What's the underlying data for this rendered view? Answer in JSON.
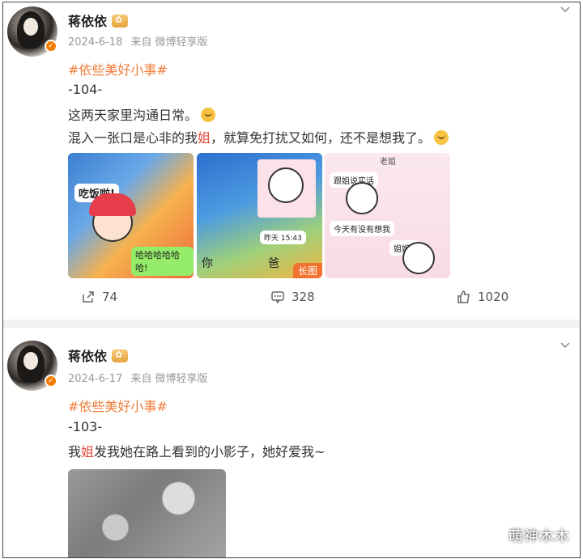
{
  "posts": [
    {
      "username": "蒋依依",
      "date": "2024-6-18",
      "source": "来自 微博轻享版",
      "topic": "#依些美好小事#",
      "number": "-104-",
      "line1": "这两天家里沟通日常。",
      "line2_pre": "混入一张口是心非的我",
      "line2_red": "姐",
      "line2_post": "，就算免打扰又如何，还不是想我了。",
      "thumbs": [
        {
          "bubble1": "吃饭啦!",
          "bubble2": "哈哈哈哈哈哈!"
        },
        {
          "bubble1": "昨天 15:43",
          "label_a": "你",
          "label_b": "爸",
          "long_tag": "长图"
        },
        {
          "bubble1": "老姐",
          "bubble2": "跟姐说实话",
          "bubble3": "今天有没有想我",
          "bubble4": "姐姐~"
        }
      ],
      "share_count": "74",
      "comment_count": "328",
      "like_count": "1020"
    },
    {
      "username": "蒋依依",
      "date": "2024-6-17",
      "source": "来自 微博轻享版",
      "topic": "#依些美好小事#",
      "number": "-103-",
      "line1_pre": "我",
      "line1_red": "姐",
      "line1_post": "发我她在路上看到的小影子，她好爱我~"
    }
  ],
  "watermark": "萌神木木",
  "colors": {
    "topic": "#f27c3b",
    "badge": "#f57c00",
    "long_tag": "#f2722f"
  }
}
